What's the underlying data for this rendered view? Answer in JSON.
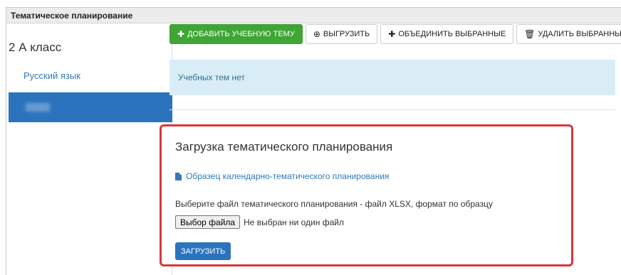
{
  "panel": {
    "title": "Тематическое планирование"
  },
  "sidebar": {
    "class_name": "2 А класс",
    "subjects": [
      {
        "label": "Русский язык",
        "active": false
      },
      {
        "label": "",
        "active": true
      }
    ]
  },
  "toolbar": {
    "add_topic": "ДОБАВИТЬ УЧЕБНУЮ ТЕМУ",
    "export": "ВЫГРУЗИТЬ",
    "merge_selected": "ОБЪЕДИНИТЬ ВЫБРАННЫЕ",
    "delete_selected": "УДАЛИТЬ ВЫБРАННЫЕ",
    "add_icon": "plus-icon",
    "export_icon": "download-circle-icon",
    "merge_icon": "plus-icon",
    "delete_icon": "trash-icon"
  },
  "info": {
    "message": "Учебных тем нет"
  },
  "upload": {
    "title": "Загрузка тематического планирования",
    "sample_link": "Образец календарно-тематического планирования",
    "instruction": "Выберите файл тематического планирования - файл XLSX, формат по образцу",
    "choose_file": "Выбор файла",
    "file_status": "Не выбран ни один файл",
    "submit": "ЗАГРУЗИТЬ"
  },
  "colors": {
    "accent_blue": "#2b74bd",
    "link_blue": "#337ab7",
    "success_green": "#3fa535",
    "info_bg": "#d9edf7",
    "highlight_red": "#d9373a"
  }
}
